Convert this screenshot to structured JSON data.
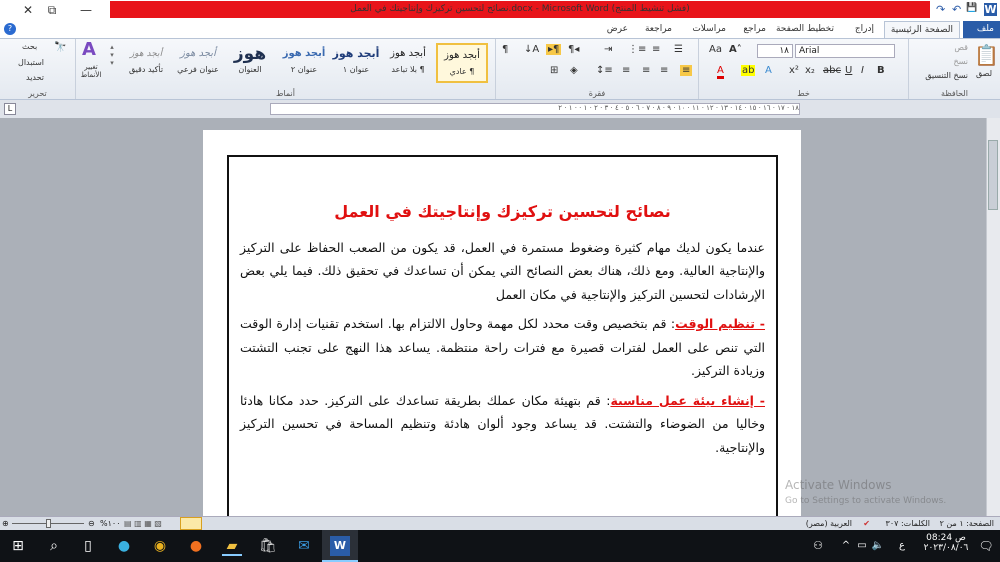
{
  "window": {
    "title": "نصائح لتحسين تركيزك وإنتاجيتك في العمل.docx - Microsoft Word (فشل تنشيط المنتج)",
    "minimize": "—",
    "restore": "⧉",
    "close": "✕"
  },
  "quick_access": {
    "save": "💾",
    "undo": "↶",
    "redo": "↷",
    "word_icon": "W"
  },
  "tabs": [
    {
      "label": "ملف"
    },
    {
      "label": "الصفحة الرئيسية"
    },
    {
      "label": "إدراج"
    },
    {
      "label": "تخطيط الصفحة"
    },
    {
      "label": "مراجع"
    },
    {
      "label": "مراسلات"
    },
    {
      "label": "مراجعة"
    },
    {
      "label": "عرض"
    }
  ],
  "ribbon": {
    "clipboard": {
      "label": "الحافظة",
      "paste": "لصق",
      "cut": "قص",
      "copy": "نسخ",
      "format_painter": "نسخ التنسيق"
    },
    "font": {
      "label": "خط",
      "font_name": "Arial",
      "font_size": "١٨"
    },
    "paragraph": {
      "label": "فقرة"
    },
    "styles": {
      "label": "أنماط",
      "change_styles": "تغيير الأنماط",
      "items": [
        {
          "sample": "أبجد هوز",
          "name": "¶ عادي"
        },
        {
          "sample": "أبجد هوز",
          "name": "¶ بلا تباعد"
        },
        {
          "sample": "أبجد هوز",
          "name": "عنوان ١"
        },
        {
          "sample": "أبجد هوز",
          "name": "عنوان ٢"
        },
        {
          "sample": "هوز",
          "name": "العنوان"
        },
        {
          "sample": "أبجد هوز",
          "name": "عنوان فرعي"
        },
        {
          "sample": "أبجد هوز",
          "name": "تأكيد دقيق"
        }
      ]
    },
    "editing": {
      "label": "تحرير",
      "find": "بحث",
      "replace": "استبدال",
      "select": "تحديد"
    }
  },
  "ruler": {
    "ticks": "١٨ · ١٧ · ١٦ · ١٥ · ١٤ · ١٣ · ١٢ · ١١ · ١٠ · ٩ · ٨ · ٧ · ٦ · ٥ · ٤ · ٣ · ٢ · ١ · · ١ · ٢"
  },
  "document": {
    "title": "نصائح لتحسين تركيزك وإنتاجيتك في العمل",
    "intro": "عندما يكون لديك مهام كثيرة وضغوط مستمرة في العمل، قد يكون من الصعب الحفاظ على التركيز والإنتاجية العالية. ومع ذلك، هناك بعض النصائح التي يمكن أن تساعدك في تحقيق ذلك. فيما يلي بعض الإرشادات لتحسين التركيز والإنتاجية في مكان العمل",
    "sections": [
      {
        "heading": "- تنظيم الوقت",
        "body": ": قم بتخصيص وقت محدد لكل مهمة وحاول الالتزام بها. استخدم تقنيات إدارة الوقت التي تنص على العمل لفترات قصيرة مع فترات راحة منتظمة. يساعد هذا النهج على تجنب التشتت وزيادة التركيز."
      },
      {
        "heading": "- إنشاء بيئة عمل مناسبة",
        "body": ": قم بتهيئة مكان عملك بطريقة تساعدك على التركيز. حدد مكانا هادئا وخاليا من الضوضاء والتشتت. قد يساعد وجود ألوان هادئة وتنظيم المساحة في تحسين التركيز والإنتاجية."
      }
    ]
  },
  "watermark": {
    "line1": "Activate Windows",
    "line2": "Go to Settings to activate Windows."
  },
  "status": {
    "page": "الصفحة: ١ من ٢",
    "words": "الكلمات: ٣٠٧",
    "language": "العربية (مصر)",
    "zoom": "%١٠٠"
  },
  "taskbar": {
    "time": "08:24 ص",
    "date": "٢٠٢٣/٠٨/٠٦",
    "lang": "ع"
  }
}
